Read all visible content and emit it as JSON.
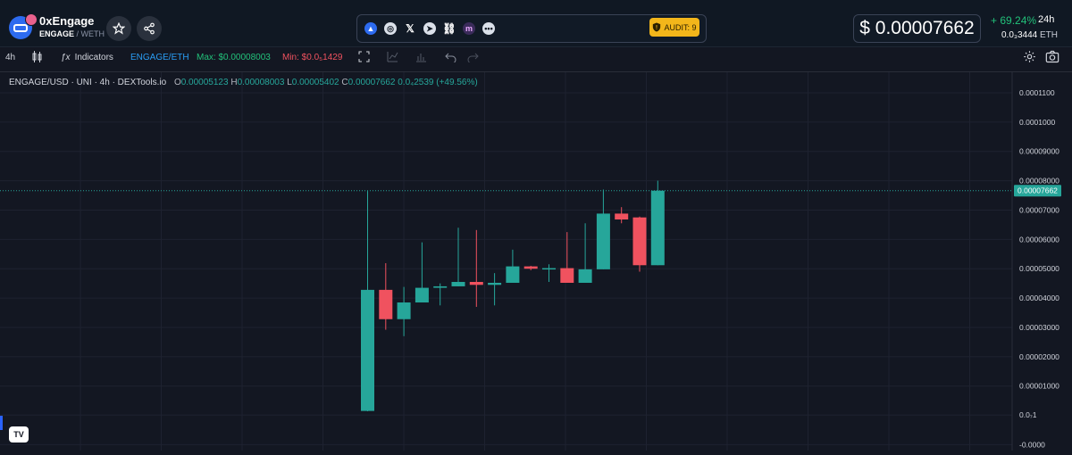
{
  "header": {
    "token_name": "0xEngage",
    "base_symbol": "ENGAGE",
    "quote_symbol": "WETH",
    "pair_separator": " / ",
    "price": "$ 0.00007662",
    "change_24h": "+ 69.24%",
    "period": "24h",
    "price_eth": "0.0₃3444",
    "eth_unit": "ETH",
    "audit_label": "AUDIT: 9",
    "favorite_icon": "star-icon",
    "share_icon": "share-icon",
    "social_icons": [
      "chart-icon",
      "globe-icon",
      "x-icon",
      "telegram-icon",
      "link-icon",
      "m-icon",
      "more-icon"
    ]
  },
  "toolbar": {
    "timeframe": "4h",
    "indicators_label": "Indicators",
    "pair_label": "ENGAGE/ETH",
    "max_label": "Max: $0.00008003",
    "min_label": "Min: $0.0₅1429"
  },
  "legend": {
    "symbol": "ENGAGE/USD · UNI · 4h · DEXTools.io",
    "o_key": "O",
    "o_val": "0.00005123",
    "h_key": "H",
    "h_val": "0.00008003",
    "l_key": "L",
    "l_val": "0.00005402",
    "c_key": "C",
    "c_val": "0.00007662",
    "change": "0.0₄2539 (+49.56%)"
  },
  "colors": {
    "up": "#26a69a",
    "down": "#f0525f",
    "background": "#131722",
    "grid": "#1e2230",
    "max_green": "#22c17a",
    "min_red": "#f0525f",
    "pair_blue": "#2a9df4",
    "audit": "#f3b61a"
  },
  "chart_data": {
    "type": "candlestick",
    "title": "ENGAGE/USD · UNI · 4h · DEXTools.io",
    "ylim": [
      -1.2e-05,
      0.000117
    ],
    "y_ticks": [
      {
        "value": 0.00011,
        "label": "0.0001100"
      },
      {
        "value": 0.0001,
        "label": "0.0001000"
      },
      {
        "value": 9e-05,
        "label": "0.00009000"
      },
      {
        "value": 8e-05,
        "label": "0.00008000"
      },
      {
        "value": 7e-05,
        "label": "0.00007000"
      },
      {
        "value": 6e-05,
        "label": "0.00006000"
      },
      {
        "value": 5e-05,
        "label": "0.00005000"
      },
      {
        "value": 4e-05,
        "label": "0.00004000"
      },
      {
        "value": 3e-05,
        "label": "0.00003000"
      },
      {
        "value": 2e-05,
        "label": "0.00002000"
      },
      {
        "value": 1e-05,
        "label": "0.00001000"
      },
      {
        "value": 1e-07,
        "label": "0.0₇1"
      },
      {
        "value": -1e-05,
        "label": "-0.0000"
      }
    ],
    "last_price": 7.662e-05,
    "last_price_label": "0.00007662",
    "candles": [
      {
        "o": 1.5e-06,
        "h": 7.65e-05,
        "l": 1.4e-06,
        "c": 4.28e-05
      },
      {
        "o": 4.28e-05,
        "h": 5.19e-05,
        "l": 2.92e-05,
        "c": 3.28e-05
      },
      {
        "o": 3.28e-05,
        "h": 4.38e-05,
        "l": 2.7e-05,
        "c": 3.85e-05
      },
      {
        "o": 3.85e-05,
        "h": 5.9e-05,
        "l": 3.85e-05,
        "c": 4.35e-05
      },
      {
        "o": 4.35e-05,
        "h": 4.5e-05,
        "l": 3.75e-05,
        "c": 4.4e-05
      },
      {
        "o": 4.4e-05,
        "h": 6.4e-05,
        "l": 4.4e-05,
        "c": 4.55e-05
      },
      {
        "o": 4.55e-05,
        "h": 6.32e-05,
        "l": 3.7e-05,
        "c": 4.45e-05
      },
      {
        "o": 4.45e-05,
        "h": 4.85e-05,
        "l": 3.75e-05,
        "c": 4.52e-05
      },
      {
        "o": 4.52e-05,
        "h": 5.65e-05,
        "l": 4.52e-05,
        "c": 5.08e-05
      },
      {
        "o": 5.08e-05,
        "h": 5.1e-05,
        "l": 4.95e-05,
        "c": 5e-05
      },
      {
        "o": 4.98e-05,
        "h": 5.15e-05,
        "l": 4.55e-05,
        "c": 5.02e-05
      },
      {
        "o": 5.02e-05,
        "h": 6.25e-05,
        "l": 4.52e-05,
        "c": 4.52e-05
      },
      {
        "o": 4.52e-05,
        "h": 6.55e-05,
        "l": 4.52e-05,
        "c": 4.98e-05
      },
      {
        "o": 4.98e-05,
        "h": 7.7e-05,
        "l": 4.98e-05,
        "c": 6.88e-05
      },
      {
        "o": 6.88e-05,
        "h": 7.1e-05,
        "l": 6.55e-05,
        "c": 6.68e-05
      },
      {
        "o": 6.75e-05,
        "h": 6.78e-05,
        "l": 4.9e-05,
        "c": 5.12e-05
      },
      {
        "o": 5.12e-05,
        "h": 8.003e-05,
        "l": 5.12e-05,
        "c": 7.662e-05
      }
    ]
  }
}
